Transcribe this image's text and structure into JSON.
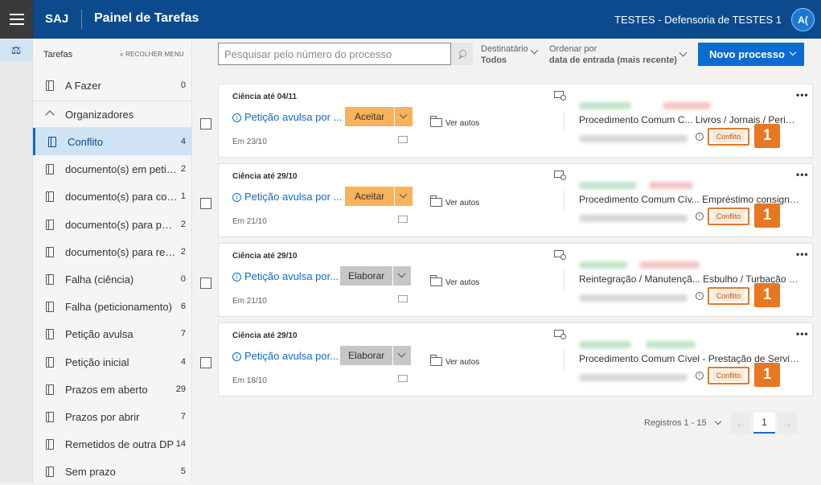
{
  "header": {
    "brand": "SAJ",
    "title": "Painel de Tarefas",
    "org": "TESTES - Defensoria de TESTES 1",
    "avatar": "A("
  },
  "sidebar": {
    "title": "Tarefas",
    "collapse": "« RECOLHER MENU",
    "todo": {
      "label": "A Fazer",
      "count": "0"
    },
    "organizers": "Organizadores",
    "items": [
      {
        "label": "Conflito",
        "count": "4"
      },
      {
        "label": "documento(s) em peticionamento",
        "count": "2"
      },
      {
        "label": "documento(s) para correção",
        "count": "1"
      },
      {
        "label": "documento(s) para peticionamento",
        "count": "2"
      },
      {
        "label": "documento(s) para revisão",
        "count": "2"
      },
      {
        "label": "Falha (ciência)",
        "count": "0"
      },
      {
        "label": "Falha (peticionamento)",
        "count": "6"
      },
      {
        "label": "Petição avulsa",
        "count": "7"
      },
      {
        "label": "Petição inicial",
        "count": "4"
      },
      {
        "label": "Prazos em aberto",
        "count": "29"
      },
      {
        "label": "Prazos por abrir",
        "count": "7"
      },
      {
        "label": "Remetidos de outra DP",
        "count": "14"
      },
      {
        "label": "Sem prazo",
        "count": "5"
      }
    ]
  },
  "toolbar": {
    "search_placeholder": "Pesquisar pelo número do processo",
    "dest_label": "Destinatário",
    "dest_value": "Todos",
    "order_label": "Ordenar por",
    "order_value": "data de entrada (mais recente)",
    "new_button": "Novo processo"
  },
  "cards": [
    {
      "ciencia": "Ciência até 04/11",
      "title": "Petição avulsa por ...",
      "action": "Aceitar",
      "ver": "Ver autos",
      "date": "Em 23/10",
      "proc": "Procedimento Comum C...  Livros / Jornais / Periódicos",
      "badge": "Conflito",
      "callout": "1"
    },
    {
      "ciencia": "Ciência até 29/10",
      "title": "Petição avulsa por ...",
      "action": "Aceitar",
      "ver": "Ver autos",
      "date": "Em 21/10",
      "proc": "Procedimento Comum Cív...  Empréstimo consignado",
      "badge": "Conflito",
      "callout": "1"
    },
    {
      "ciencia": "Ciência até 29/10",
      "title": "Petição avulsa por...",
      "action": "Elaborar",
      "ver": "Ver autos",
      "date": "Em 21/10",
      "proc": "Reintegração / Manutençã...  Esbulho / Turbação / Ameaça",
      "badge": "Conflito",
      "callout": "1"
    },
    {
      "ciencia": "Ciência até 29/10",
      "title": "Petição avulsa por...",
      "action": "Elaborar",
      "ver": "Ver autos",
      "date": "Em 18/10",
      "proc": "Procedimento Comum Cível - Prestação de Serviços",
      "badge": "Conflito",
      "callout": "1"
    }
  ],
  "pagination": {
    "label": "Registros 1 - 15",
    "current": "1"
  },
  "colors": {
    "primary": "#0b4a8c",
    "accent": "#0b6bd1",
    "accept": "#f7b35b",
    "callout": "#e87722"
  }
}
